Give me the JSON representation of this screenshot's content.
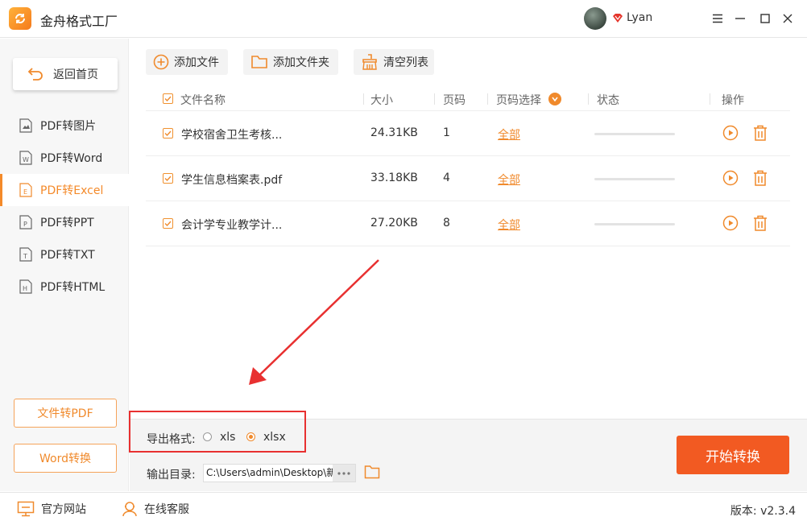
{
  "app": {
    "title": "金舟格式工厂",
    "username": "Lyan"
  },
  "sidebar": {
    "home": "返回首页",
    "items": [
      {
        "label": "PDF转图片",
        "icon": "image-file-icon",
        "active": false
      },
      {
        "label": "PDF转Word",
        "icon": "word-file-icon",
        "active": false
      },
      {
        "label": "PDF转Excel",
        "icon": "excel-file-icon",
        "active": true
      },
      {
        "label": "PDF转PPT",
        "icon": "ppt-file-icon",
        "active": false
      },
      {
        "label": "PDF转TXT",
        "icon": "txt-file-icon",
        "active": false
      },
      {
        "label": "PDF转HTML",
        "icon": "html-file-icon",
        "active": false
      }
    ],
    "to_pdf": "文件转PDF",
    "word_convert": "Word转换"
  },
  "toolbar": {
    "add_file": "添加文件",
    "add_folder": "添加文件夹",
    "clear_list": "清空列表"
  },
  "table": {
    "headers": {
      "name": "文件名称",
      "size": "大小",
      "pages": "页码",
      "page_select": "页码选择",
      "status": "状态",
      "action": "操作"
    },
    "rows": [
      {
        "name": "学校宿舍卫生考核...",
        "size": "24.31KB",
        "pages": "1",
        "page_select": "全部",
        "progress": 0
      },
      {
        "name": "学生信息档案表.pdf",
        "size": "33.18KB",
        "pages": "4",
        "page_select": "全部",
        "progress": 0
      },
      {
        "name": "会计学专业教学计...",
        "size": "27.20KB",
        "pages": "8",
        "page_select": "全部",
        "progress": 0
      }
    ]
  },
  "export": {
    "label": "导出格式:",
    "options": [
      "xls",
      "xlsx"
    ],
    "selected": "xlsx"
  },
  "output": {
    "label": "输出目录:",
    "path": "C:\\Users\\admin\\Desktop\\新"
  },
  "start_button": "开始转换",
  "statusbar": {
    "website": "官方网站",
    "support": "在线客服",
    "version": "版本: v2.3.4"
  },
  "colors": {
    "accent": "#f08a2c",
    "start": "#f25a22",
    "highlight": "#e83030"
  }
}
